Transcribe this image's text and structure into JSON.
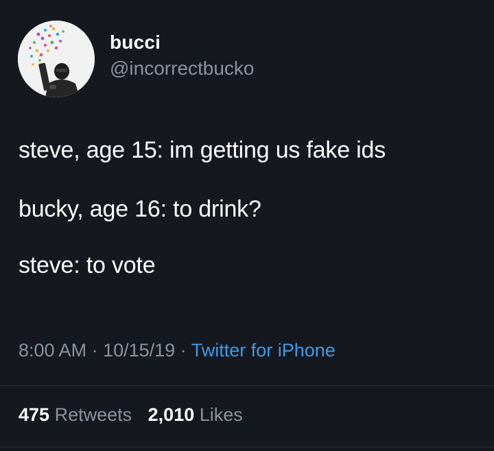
{
  "user": {
    "display_name": "bucci",
    "handle": "@incorrectbucko",
    "avatar_icon": "profile-photo"
  },
  "tweet": {
    "lines": [
      "steve, age 15: im getting us fake ids",
      "bucky, age 16: to drink?",
      "steve: to vote"
    ]
  },
  "meta": {
    "time": "8:00 AM",
    "separator": " · ",
    "date": "10/15/19",
    "source": "Twitter for iPhone"
  },
  "stats": {
    "retweets_count": "475",
    "retweets_label": "Retweets",
    "likes_count": "2,010",
    "likes_label": "Likes"
  },
  "colors": {
    "background": "#15181f",
    "text_primary": "#ffffff",
    "text_secondary": "#8a949e",
    "link": "#3e9be8"
  }
}
